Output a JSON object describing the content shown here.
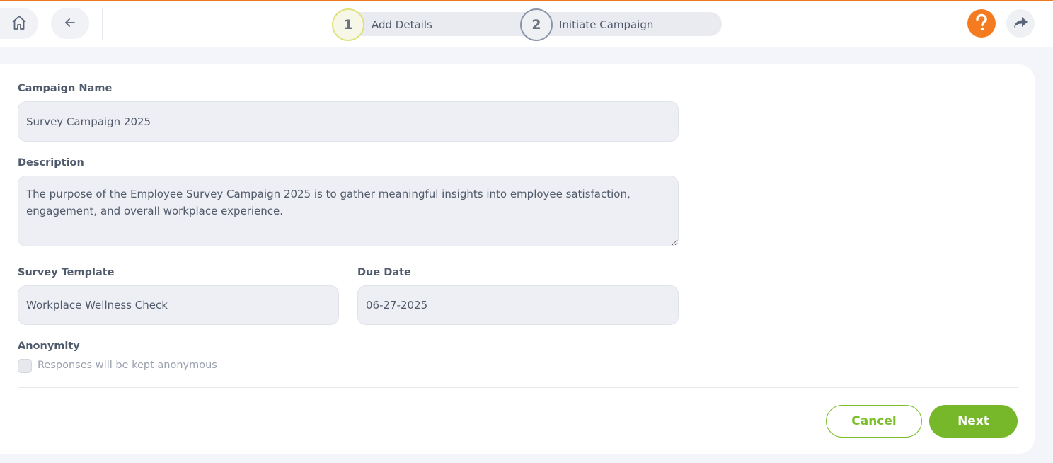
{
  "header": {
    "home_icon": "home-icon",
    "back_icon": "arrow-left-icon",
    "help_icon": "question-icon",
    "share_icon": "share-arrow-icon",
    "accent_color": "#f47b20"
  },
  "stepper": {
    "steps": [
      {
        "number": "1",
        "label": "Add Details",
        "state": "active"
      },
      {
        "number": "2",
        "label": "Initiate Campaign",
        "state": "upcoming"
      }
    ]
  },
  "form": {
    "campaign_name": {
      "label": "Campaign Name",
      "value": "Survey Campaign 2025"
    },
    "description": {
      "label": "Description",
      "value": "The purpose of the Employee Survey Campaign 2025 is to gather meaningful insights into employee satisfaction, engagement, and overall workplace experience."
    },
    "survey_template": {
      "label": "Survey Template",
      "value": "Workplace Wellness Check"
    },
    "due_date": {
      "label": "Due Date",
      "value": "06-27-2025"
    },
    "anonymity": {
      "label": "Anonymity",
      "checkbox_label": "Responses will be kept anonymous",
      "checked": false
    }
  },
  "actions": {
    "cancel_label": "Cancel",
    "next_label": "Next",
    "primary_color": "#77b82a"
  }
}
